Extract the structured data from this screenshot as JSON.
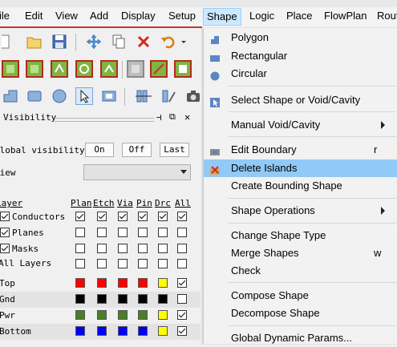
{
  "menubar": {
    "items": [
      {
        "label": "File"
      },
      {
        "label": "Edit"
      },
      {
        "label": "View"
      },
      {
        "label": "Add"
      },
      {
        "label": "Display"
      },
      {
        "label": "Setup"
      },
      {
        "label": "Shape"
      },
      {
        "label": "Logic"
      },
      {
        "label": "Place"
      },
      {
        "label": "FlowPlan"
      },
      {
        "label": "Rout"
      }
    ]
  },
  "visibility": {
    "title": "Visibility",
    "global_label": "Global visibility",
    "on_button": "On",
    "off_button": "Off",
    "last_button": "Last",
    "view_label": "View",
    "view_value": "",
    "columns": [
      "Layer",
      "Plan",
      "Etch",
      "Via",
      "Pin",
      "Drc",
      "All"
    ],
    "groups": [
      {
        "label": "Conductors",
        "checked": true,
        "cols": [
          true,
          true,
          true,
          true,
          true,
          true
        ]
      },
      {
        "label": "Planes",
        "checked": true,
        "cols": [
          false,
          false,
          false,
          false,
          false,
          false
        ]
      },
      {
        "label": "Masks",
        "checked": true,
        "cols": [
          false,
          false,
          false,
          false,
          false,
          false
        ]
      },
      {
        "label": "All Layers",
        "checked": false,
        "cols": [
          false,
          false,
          false,
          false,
          false,
          false
        ]
      }
    ],
    "layers": [
      {
        "label": "Top",
        "colors": [
          "#ff0000",
          "#ff0000",
          "#ff0000",
          "#ff0000",
          "#ffff00"
        ],
        "all": true
      },
      {
        "label": "Gnd",
        "colors": [
          "#000000",
          "#000000",
          "#000000",
          "#000000",
          "#000000"
        ],
        "all": false
      },
      {
        "label": "Pwr",
        "colors": [
          "#4a7f2a",
          "#4a7f2a",
          "#4a7f2a",
          "#4a7f2a",
          "#ffff00"
        ],
        "all": true
      },
      {
        "label": "Bottom",
        "colors": [
          "#0000ff",
          "#0000ff",
          "#0000ff",
          "#0000ff",
          "#ffff00"
        ],
        "all": true
      }
    ]
  },
  "shape_menu": {
    "items": [
      {
        "label": "Polygon",
        "shortcut": "",
        "submenu": false,
        "icon": "polygon-icon",
        "highlight": false
      },
      {
        "label": "Rectangular",
        "shortcut": "",
        "submenu": false,
        "icon": "rectangle-icon",
        "highlight": false
      },
      {
        "label": "Circular",
        "shortcut": "",
        "submenu": false,
        "icon": "circle-icon",
        "highlight": false
      },
      {
        "label": "Select Shape or Void/Cavity",
        "shortcut": "",
        "submenu": false,
        "icon": "select-shape-icon",
        "highlight": false
      },
      {
        "label": "Manual Void/Cavity",
        "shortcut": "",
        "submenu": true,
        "icon": "",
        "highlight": false
      },
      {
        "label": "Edit Boundary",
        "shortcut": "r",
        "submenu": false,
        "icon": "edit-boundary-icon",
        "highlight": false
      },
      {
        "label": "Delete Islands",
        "shortcut": "",
        "submenu": false,
        "icon": "delete-islands-icon",
        "highlight": true
      },
      {
        "label": "Create Bounding Shape",
        "shortcut": "",
        "submenu": false,
        "icon": "",
        "highlight": false
      },
      {
        "label": "Shape Operations",
        "shortcut": "",
        "submenu": true,
        "icon": "",
        "highlight": false
      },
      {
        "label": "Change Shape Type",
        "shortcut": "",
        "submenu": false,
        "icon": "",
        "highlight": false
      },
      {
        "label": "Merge Shapes",
        "shortcut": "w",
        "submenu": false,
        "icon": "",
        "highlight": false
      },
      {
        "label": "Check",
        "shortcut": "",
        "submenu": false,
        "icon": "",
        "highlight": false
      },
      {
        "label": "Compose Shape",
        "shortcut": "",
        "submenu": false,
        "icon": "",
        "highlight": false
      },
      {
        "label": "Decompose Shape",
        "shortcut": "",
        "submenu": false,
        "icon": "",
        "highlight": false
      },
      {
        "label": "Global Dynamic Params...",
        "shortcut": "",
        "submenu": false,
        "icon": "",
        "highlight": false
      }
    ]
  },
  "colors": {
    "accent": "#91c9f7",
    "active_menu": "#cce8ff",
    "red_bar": "#c0392b"
  }
}
